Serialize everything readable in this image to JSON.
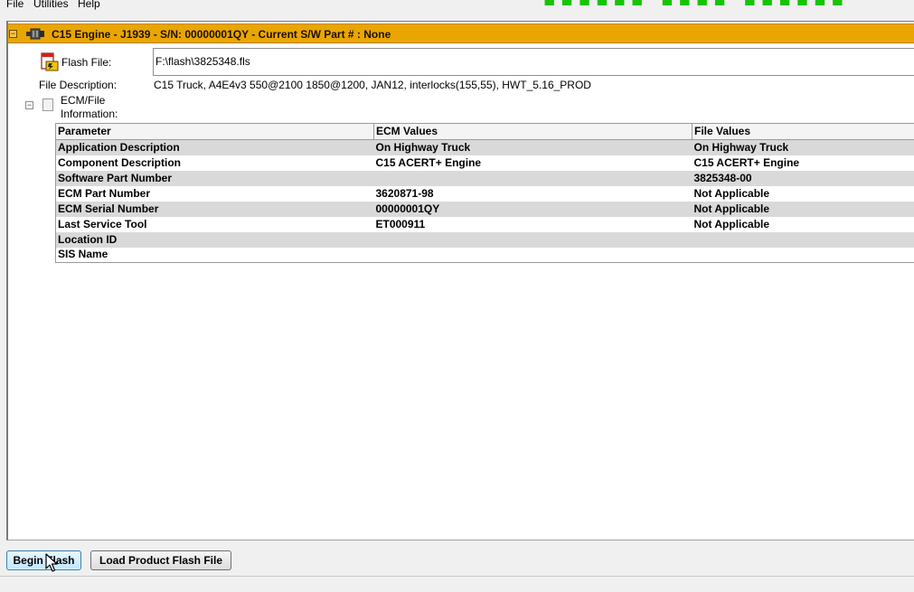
{
  "menu": [
    {
      "label": "File"
    },
    {
      "label": "Utilities"
    },
    {
      "label": "Help"
    }
  ],
  "engine": {
    "title": "C15 Engine - J1939 - S/N: 00000001QY - Current S/W Part # : None",
    "collapse_glyph": "−",
    "icon": "engine-connector-icon",
    "accent_color": "#eaa600"
  },
  "flash": {
    "label": "Flash File:",
    "value": "F:\\flash\\3825348.fls",
    "icon": "flash-file-icon"
  },
  "description": {
    "label": "File Description:",
    "value": "C15 Truck, A4E4v3 550@2100 1850@1200, JAN12, interlocks(155,55), HWT_5.16_PROD"
  },
  "ecm_info": {
    "label_line1": "ECM/File",
    "label_line2": "Information:",
    "collapse_glyph": "−"
  },
  "table": {
    "headers": [
      "Parameter",
      "ECM Values",
      "File Values"
    ],
    "rows": [
      [
        "Application Description",
        "On Highway Truck",
        "On Highway Truck"
      ],
      [
        "Component Description",
        "C15 ACERT+ Engine",
        "C15 ACERT+ Engine"
      ],
      [
        "Software Part Number",
        "",
        "3825348-00"
      ],
      [
        "ECM Part Number",
        "3620871-98",
        "Not Applicable"
      ],
      [
        "ECM Serial Number",
        "00000001QY",
        "Not Applicable"
      ],
      [
        "Last Service Tool",
        "ET000911",
        "Not Applicable"
      ],
      [
        "Location ID",
        "",
        ""
      ],
      [
        "SIS Name",
        "",
        ""
      ]
    ]
  },
  "buttons": {
    "begin_flash": "Begin Flash",
    "load_flash": "Load Product Flash File"
  }
}
